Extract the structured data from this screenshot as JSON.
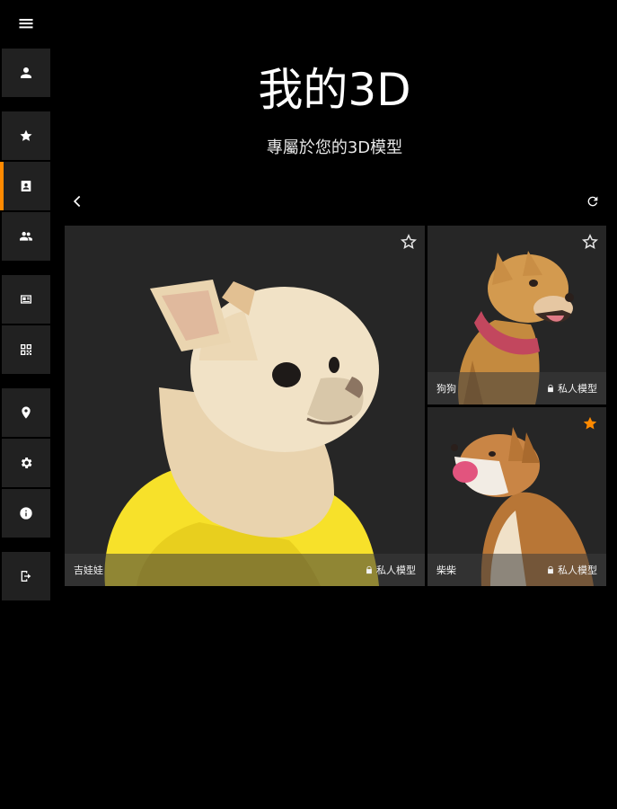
{
  "header": {
    "title": "我的3D",
    "subtitle": "專屬於您的3D模型"
  },
  "sidebar": {
    "items": [
      {
        "icon": "person-icon"
      },
      {
        "icon": "star-icon"
      },
      {
        "icon": "contact-icon",
        "active": true
      },
      {
        "icon": "group-icon"
      },
      {
        "icon": "id-card-icon"
      },
      {
        "icon": "qr-code-icon"
      },
      {
        "icon": "location-icon"
      },
      {
        "icon": "gear-icon"
      },
      {
        "icon": "info-icon"
      },
      {
        "icon": "exit-icon"
      }
    ]
  },
  "models": [
    {
      "name": "吉娃娃",
      "privacy": "私人模型",
      "favorite": false
    },
    {
      "name": "狗狗",
      "privacy": "私人模型",
      "favorite": false
    },
    {
      "name": "柴柴",
      "privacy": "私人模型",
      "favorite": true
    }
  ],
  "colors": {
    "accent": "#ff8a00",
    "tile": "#212121",
    "card": "#262626"
  }
}
